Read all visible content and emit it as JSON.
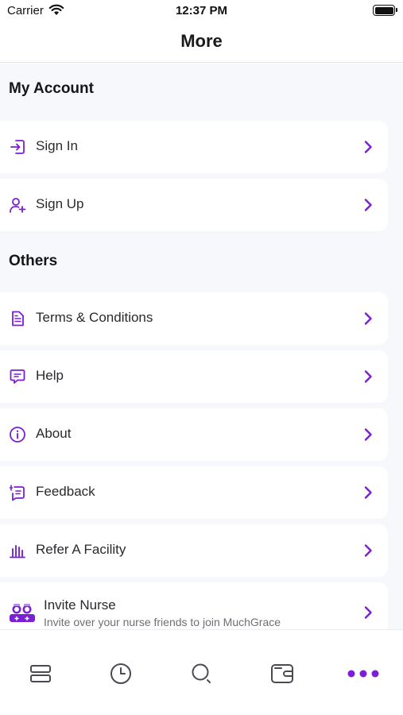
{
  "status_bar": {
    "carrier": "Carrier",
    "time": "12:37 PM"
  },
  "nav": {
    "title": "More"
  },
  "sections": {
    "account": {
      "title": "My Account",
      "items": [
        {
          "label": "Sign In",
          "icon": "sign-in-icon"
        },
        {
          "label": "Sign Up",
          "icon": "add-user-icon"
        }
      ]
    },
    "others": {
      "title": "Others",
      "items": [
        {
          "label": "Terms & Conditions",
          "icon": "document-icon"
        },
        {
          "label": "Help",
          "icon": "help-chat-icon"
        },
        {
          "label": "About",
          "icon": "info-icon"
        },
        {
          "label": "Feedback",
          "icon": "feedback-icon"
        },
        {
          "label": "Refer A Facility",
          "icon": "facility-chart-icon"
        },
        {
          "label": "Invite Nurse",
          "sublabel": "Invite over your nurse friends to join MuchGrace",
          "icon": "nurses-illustration-icon"
        }
      ]
    }
  },
  "tab_bar": {
    "tabs": [
      {
        "icon": "stack-list-icon"
      },
      {
        "icon": "clock-icon"
      },
      {
        "icon": "search-icon"
      },
      {
        "icon": "wallet-icon"
      },
      {
        "icon": "more-dots-icon",
        "active": true
      }
    ]
  },
  "colors": {
    "accent": "#7a1fd6",
    "tab_inactive": "#4a4a55",
    "background": "#f7f8fc"
  }
}
